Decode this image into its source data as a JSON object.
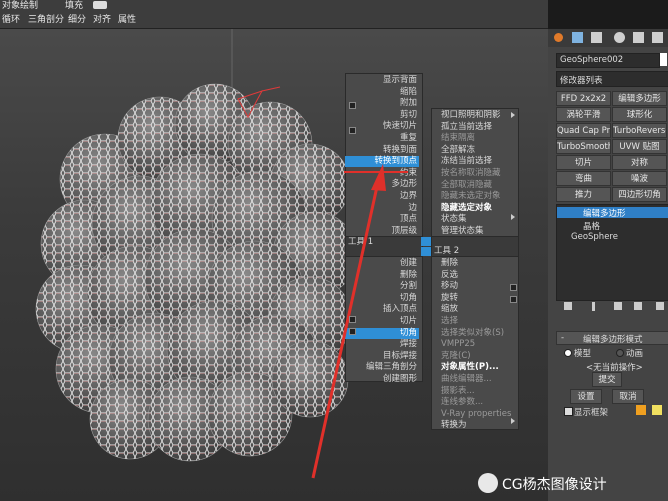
{
  "top_toolbar": {
    "row1": [
      "对象绘制",
      "填充"
    ],
    "row2": [
      "循环",
      "三角剖分",
      "细分",
      "对齐",
      "属性"
    ]
  },
  "quad_menu": {
    "top_left": [
      "显示背面",
      "缩陷",
      "附加",
      "剪切",
      "快速切片",
      "重复",
      "转换到面",
      "转换到顶点",
      "约束",
      "多边形",
      "边界",
      "边",
      "顶点",
      "顶层级"
    ],
    "top_right": [
      "视口照明和阴影",
      "孤立当前选择",
      "结束隔离",
      "全部解冻",
      "冻结当前选择",
      "按名称取消隐藏",
      "全部取消隐藏",
      "隐藏未选定对象",
      "隐藏选定对象",
      "状态集",
      "管理状态集"
    ],
    "header_left": "工具 1",
    "header_right": "工具 2",
    "bottom_left": [
      "创建",
      "删除",
      "分割",
      "切角",
      "插入顶点",
      "切片",
      "切角",
      "焊接",
      "目标焊接",
      "编辑三角剖分",
      "创建图形"
    ],
    "bottom_right": [
      "删除",
      "反选",
      "移动",
      "旋转",
      "缩放",
      "选择",
      "选择类似对象(S)",
      "VMPP25",
      "克隆(C)",
      "对象属性(P)...",
      "曲线编辑器...",
      "摄影表...",
      "连线参数...",
      "V-Ray properties",
      "转换为"
    ],
    "highlighted_top": "转换到顶点",
    "highlighted_bottom": "切角"
  },
  "command_panel": {
    "object_name": "GeoSphere002",
    "modifier_list_label": "修改器列表",
    "modifier_buttons": [
      "FFD 2x2x2",
      "编辑多边形",
      "涡轮平滑",
      "球形化",
      "Quad Cap Pro",
      "TurboReverse",
      "TurboSmooth Pro",
      "UVW 贴图",
      "切片",
      "对称",
      "弯曲",
      "噪波",
      "推力",
      "四边形切角"
    ],
    "stack": [
      "编辑多边形",
      "晶格",
      "GeoSphere"
    ],
    "rollout_title": "编辑多边形模式",
    "mode_model": "模型",
    "mode_animate": "动画",
    "no_current_op": "<无当前操作>",
    "commit": "提交",
    "settings": "设置",
    "cancel": "取消",
    "show_cage": "显示框架"
  },
  "watermark": {
    "text": "CG杨杰图像设计"
  },
  "colors": {
    "highlight": "#2f8fd6",
    "arrow": "#e0302a",
    "menu_bg": "#4a4a4a",
    "panel_bg": "#444444"
  }
}
